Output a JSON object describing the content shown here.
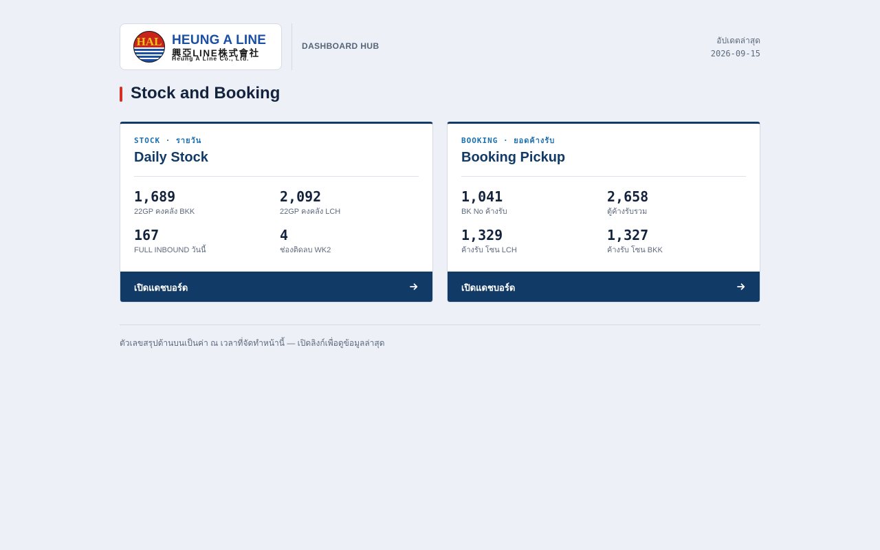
{
  "header": {
    "logo": {
      "mark_text": "HAL",
      "main_text": "HEUNG A LINE",
      "sub_text": "興亞LINE株式會社",
      "tagline": "Heung A Line Co., Ltd."
    },
    "hub_label": "DASHBOARD HUB",
    "update_label": "อัปเดตล่าสุด",
    "update_date": "2026-09-15"
  },
  "section": {
    "title": "Stock and Booking",
    "accent_color": "#d62f24"
  },
  "cards": [
    {
      "tag": "STOCK · รายวัน",
      "title": "Daily Stock",
      "metrics": [
        {
          "value": "1,689",
          "label": "22GP คงคลัง BKK"
        },
        {
          "value": "2,092",
          "label": "22GP คงคลัง LCH"
        },
        {
          "value": "167",
          "label": "FULL INBOUND วันนี้"
        },
        {
          "value": "4",
          "label": "ช่องติดลบ WK2"
        }
      ],
      "footer_label": "เปิดแดชบอร์ด",
      "footer_icon": "arrow-right-icon"
    },
    {
      "tag": "BOOKING · ยอดค้างรับ",
      "title": "Booking Pickup",
      "metrics": [
        {
          "value": "1,041",
          "label": "BK No ค้างรับ"
        },
        {
          "value": "2,658",
          "label": "ตู้ค้างรับรวม"
        },
        {
          "value": "1,329",
          "label": "ค้างรับ โซน LCH"
        },
        {
          "value": "1,327",
          "label": "ค้างรับ โซน BKK"
        }
      ],
      "footer_label": "เปิดแดชบอร์ด",
      "footer_icon": "arrow-right-icon"
    }
  ],
  "footer_note": "ตัวเลขสรุปด้านบนเป็นค่า ณ เวลาที่จัดทำหน้านี้ — เปิดลิงก์เพื่อดูข้อมูลล่าสุด",
  "colors": {
    "brand_navy": "#123a66",
    "tag_blue": "#1a6fb0",
    "background": "#edf1f7"
  }
}
